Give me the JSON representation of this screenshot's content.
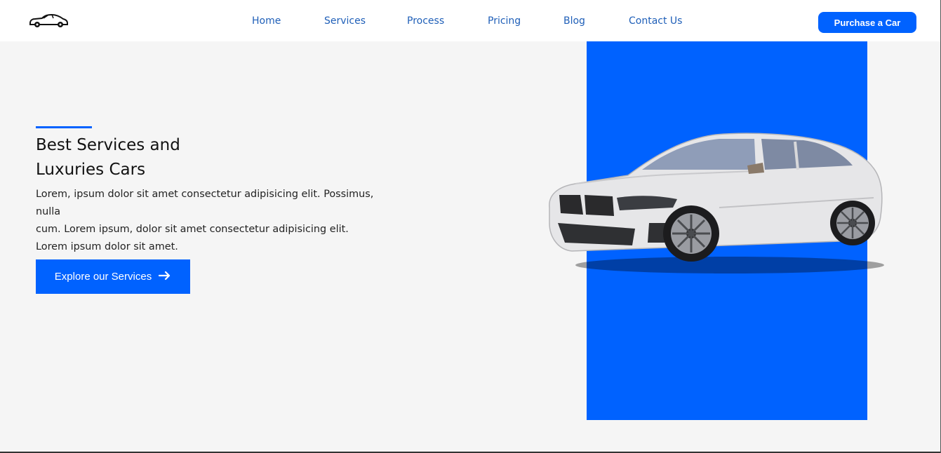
{
  "nav": {
    "logo_icon": "car-icon",
    "links": [
      "Home",
      "Services",
      "Process",
      "Pricing",
      "Blog",
      "Contact Us"
    ],
    "purchase_label": "Purchase a Car"
  },
  "hero": {
    "title_line1": "Best Services and",
    "title_line2": "Luxuries Cars",
    "description_line1": "Lorem, ipsum dolor sit amet consectetur adipisicing elit. Possimus, nulla",
    "description_line2": "cum. Lorem ipsum, dolor sit amet consectetur adipisicing elit.",
    "description_line3": "Lorem ipsum dolor sit amet.",
    "cta_label": "Explore our Services",
    "cta_icon": "arrow-right-icon",
    "image": "white-sedan-car"
  },
  "colors": {
    "accent": "#0062ff",
    "nav_text": "#1f5fb8",
    "background": "#f5f5f5"
  }
}
